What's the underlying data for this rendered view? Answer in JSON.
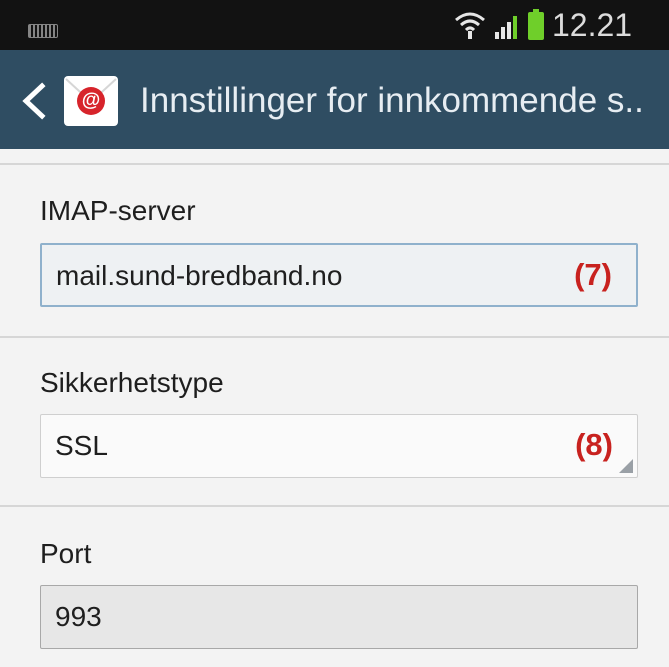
{
  "status_bar": {
    "time": "12.21",
    "icons": [
      "keyboard-icon",
      "wifi-icon",
      "signal-icon",
      "battery-icon"
    ],
    "battery_color": "#6fcf2a"
  },
  "action_bar": {
    "title": "Innstillinger for innkommende s..",
    "back_icon": "chevron-left-icon",
    "app_icon": "email-app-icon",
    "app_icon_glyph": "@",
    "background": "#2f4d62"
  },
  "fields": {
    "imap": {
      "label": "IMAP-server",
      "value": "mail.sund-bredband.no",
      "marker": "(7)"
    },
    "security": {
      "label": "Sikkerhetstype",
      "value": "SSL",
      "marker": "(8)"
    },
    "port": {
      "label": "Port",
      "value": "993"
    }
  },
  "colors": {
    "marker": "#c8221f",
    "focused_border": "#8fb1cc"
  }
}
